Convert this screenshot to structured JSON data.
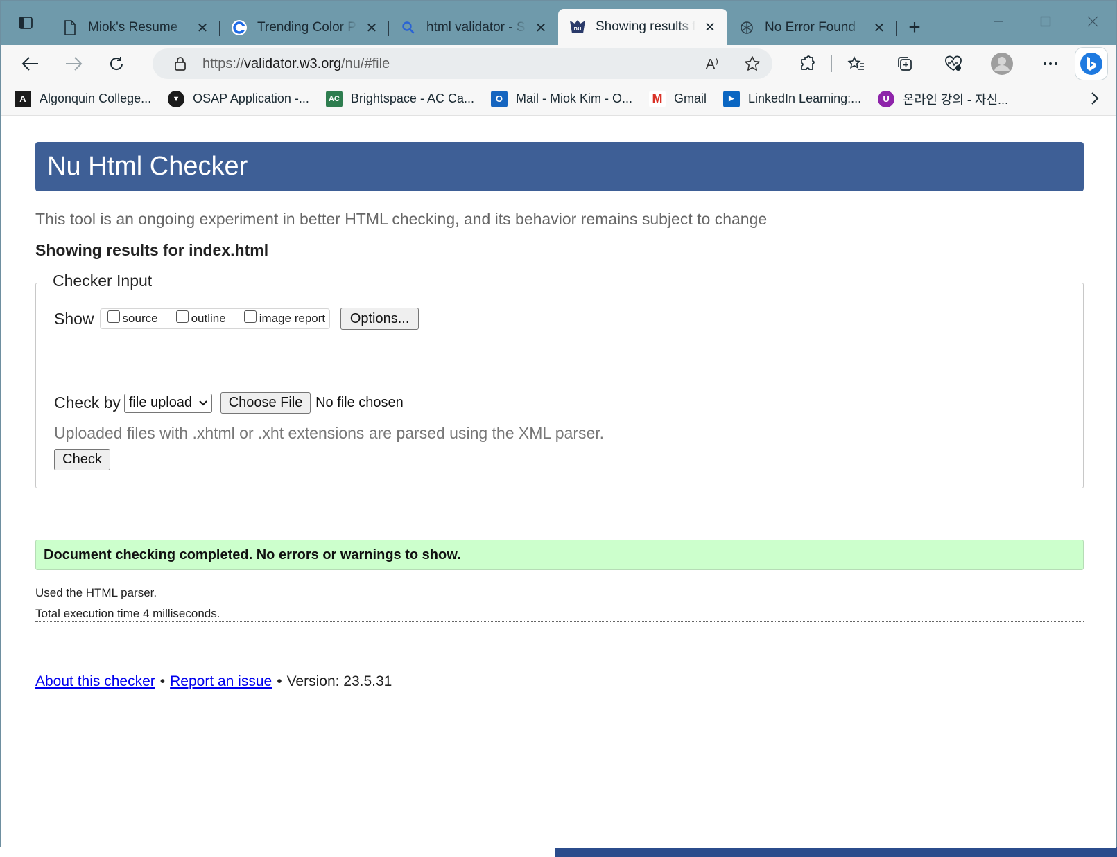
{
  "browser": {
    "tabs": [
      {
        "title": "Miok's Resume",
        "icon": "document-icon",
        "active": false
      },
      {
        "title": "Trending Color Palettes",
        "icon": "coolors-icon",
        "active": false
      },
      {
        "title": "html validator - Search",
        "icon": "search-icon",
        "active": false
      },
      {
        "title": "Showing results for index.html",
        "icon": "nu-icon",
        "active": true
      },
      {
        "title": "No Error Found",
        "icon": "chatgpt-icon",
        "active": false
      }
    ],
    "url_prefix": "https://",
    "url_host": "validator.w3.org",
    "url_path": "/nu/#file",
    "read_aloud": "A⁾",
    "bookmarks": [
      {
        "label": "Algonquin College...",
        "color": "#1b1b1b",
        "glyph": "A"
      },
      {
        "label": "OSAP Application -...",
        "color": "#1b1b1b",
        "glyph": "▼"
      },
      {
        "label": "Brightspace - AC Ca...",
        "color": "#2e7d4f",
        "glyph": "AC"
      },
      {
        "label": "Mail - Miok Kim - O...",
        "color": "#1565c0",
        "glyph": "O"
      },
      {
        "label": "Gmail",
        "color": "#d93025",
        "glyph": "M"
      },
      {
        "label": "LinkedIn Learning:...",
        "color": "#0a66c2",
        "glyph": "▶"
      },
      {
        "label": "온라인 강의 - 자신...",
        "color": "#8e24aa",
        "glyph": "U"
      }
    ]
  },
  "page": {
    "title": "Nu Html Checker",
    "intro": "This tool is an ongoing experiment in better HTML checking, and its behavior remains subject to change",
    "results_for": "Showing results for index.html",
    "checker_input": {
      "legend": "Checker Input",
      "show_label": "Show",
      "show_options": [
        "source",
        "outline",
        "image report"
      ],
      "options_button": "Options...",
      "check_by_label": "Check by",
      "check_by_value": "file upload",
      "choose_file_button": "Choose File",
      "no_file": "No file chosen",
      "xml_note": "Uploaded files with .xhtml or .xht extensions are parsed using the XML parser.",
      "check_button": "Check"
    },
    "result_message": "Document checking completed. No errors or warnings to show.",
    "parser_note": "Used the HTML parser.",
    "execution_time": "Total execution time 4 milliseconds.",
    "footer": {
      "about_link": "About this checker",
      "separator": "•",
      "report_link": "Report an issue",
      "version": "Version: 23.5.31"
    }
  },
  "colors": {
    "tabstrip": "#6f9aab",
    "header_bar": "#3e5f96",
    "success_bg": "#ccffcc",
    "link": "#0000ee"
  }
}
